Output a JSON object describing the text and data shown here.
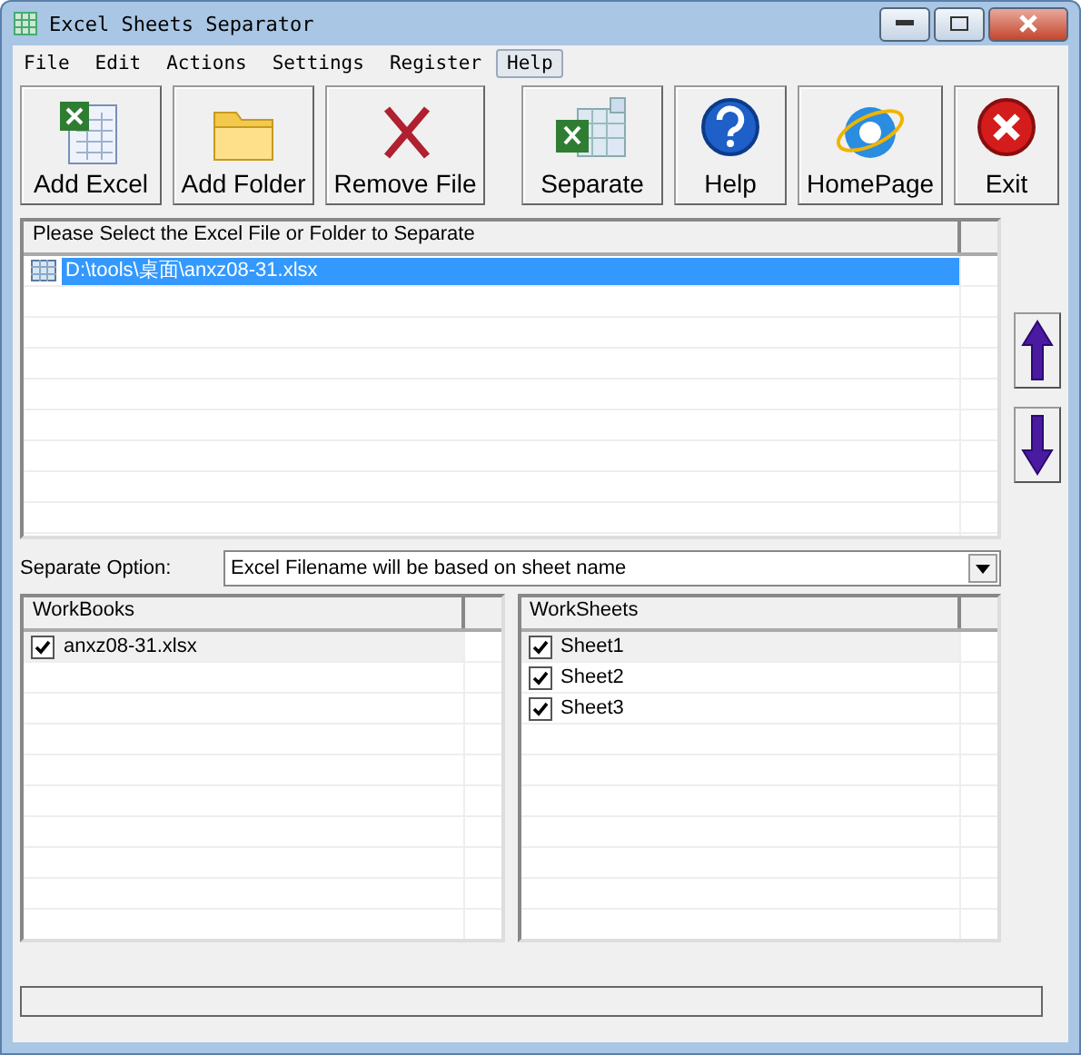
{
  "window": {
    "title": "Excel Sheets Separator"
  },
  "menu": [
    {
      "label": "File",
      "selected": false
    },
    {
      "label": "Edit",
      "selected": false
    },
    {
      "label": "Actions",
      "selected": false
    },
    {
      "label": "Settings",
      "selected": false
    },
    {
      "label": "Register",
      "selected": false
    },
    {
      "label": "Help",
      "selected": true
    }
  ],
  "toolbar": [
    {
      "kind": "add-excel",
      "label": "Add Excel"
    },
    {
      "kind": "add-folder",
      "label": "Add Folder"
    },
    {
      "kind": "remove",
      "label": "Remove File"
    },
    {
      "kind": "separate",
      "label": "Separate"
    },
    {
      "kind": "help",
      "label": "Help"
    },
    {
      "kind": "homepage",
      "label": "HomePage"
    },
    {
      "kind": "exit",
      "label": "Exit"
    }
  ],
  "file_list": {
    "column": "Please Select the Excel File or Folder to Separate",
    "rows": [
      {
        "text": "D:\\tools\\桌面\\anxz08-31.xlsx",
        "selected": true
      }
    ]
  },
  "separate_option": {
    "label": "Separate Option:",
    "value": "Excel Filename will be based on sheet name"
  },
  "workbooks": {
    "column": "WorkBooks",
    "rows": [
      {
        "text": "anxz08-31.xlsx",
        "checked": true
      }
    ]
  },
  "worksheets": {
    "column": "WorkSheets",
    "rows": [
      {
        "text": "Sheet1",
        "checked": true
      },
      {
        "text": "Sheet2",
        "checked": true
      },
      {
        "text": "Sheet3",
        "checked": true
      }
    ]
  },
  "progress": {
    "level": 0
  }
}
